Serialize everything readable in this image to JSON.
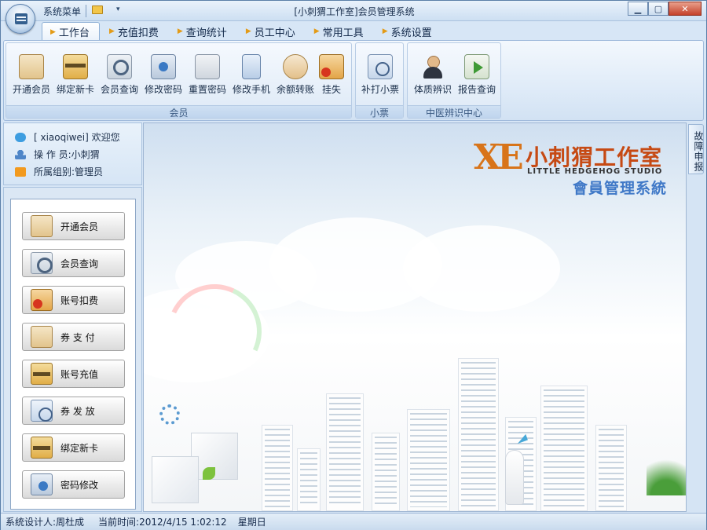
{
  "window": {
    "title": "[小刺猬工作室]会员管理系统",
    "system_menu": "系统菜单",
    "dropdown_glyph": "▾"
  },
  "tabs": [
    {
      "label": "工作台",
      "active": true
    },
    {
      "label": "充值扣费"
    },
    {
      "label": "查询统计"
    },
    {
      "label": "员工中心"
    },
    {
      "label": "常用工具"
    },
    {
      "label": "系统设置"
    }
  ],
  "ribbon": {
    "groups": [
      {
        "label": "会员",
        "buttons": [
          "开通会员",
          "绑定新卡",
          "会员查询",
          "修改密码",
          "重置密码",
          "修改手机",
          "余额转账",
          "挂失"
        ]
      },
      {
        "label": "小票",
        "buttons": [
          "补打小票"
        ]
      },
      {
        "label": "中医辨识中心",
        "buttons": [
          "体质辨识",
          "报告查询"
        ]
      }
    ]
  },
  "user_info": {
    "welcome": "[ xiaoqiwei] 欢迎您",
    "operator": "操 作 员:小刺猬",
    "group": "所属组别:管理员"
  },
  "side_buttons": [
    "开通会员",
    "会员查询",
    "账号扣费",
    "券 支 付",
    "账号充值",
    "券 发 放",
    "绑定新卡",
    "密码修改"
  ],
  "right_tab": "故障申报",
  "logo": {
    "mark": "XE",
    "name": "小刺猬工作室",
    "english": "LITTLE HEDGEHOG STUDIO",
    "system": "會員管理系統"
  },
  "status": {
    "designer": "系统设计人:周杜成",
    "time": "当前时间:2012/4/15 1:02:12",
    "weekday": "星期日"
  },
  "colors": {
    "accent": "#3f78c7",
    "logo_orange": "#c64a14",
    "ribbon_bg": "#dce9f7"
  }
}
